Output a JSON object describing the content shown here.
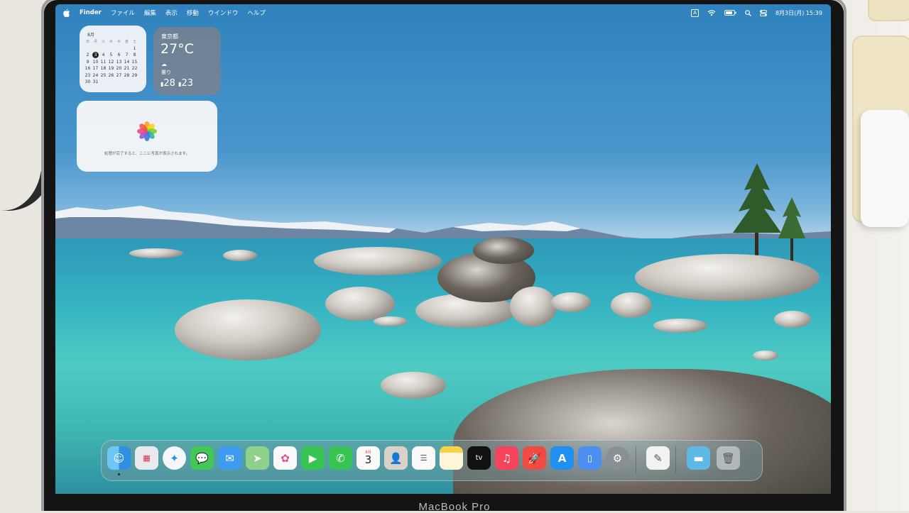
{
  "menubar": {
    "app_name": "Finder",
    "menus": [
      "ファイル",
      "編集",
      "表示",
      "移動",
      "ウインドウ",
      "ヘルプ"
    ],
    "input_source": "A",
    "clock": "8月3日(月)  15:39"
  },
  "calendar_widget": {
    "month": "8月",
    "weekdays": [
      "日",
      "月",
      "火",
      "水",
      "木",
      "金",
      "土"
    ],
    "weeks": [
      [
        "",
        "",
        "",
        "",
        "",
        "",
        "1"
      ],
      [
        "2",
        "3",
        "4",
        "5",
        "6",
        "7",
        "8"
      ],
      [
        "9",
        "10",
        "11",
        "12",
        "13",
        "14",
        "15"
      ],
      [
        "16",
        "17",
        "18",
        "19",
        "20",
        "21",
        "22"
      ],
      [
        "23",
        "24",
        "25",
        "26",
        "27",
        "28",
        "29"
      ],
      [
        "30",
        "31",
        "",
        "",
        "",
        "",
        ""
      ]
    ],
    "today": "3"
  },
  "weather_widget": {
    "city": "東京都",
    "temperature": "27°C",
    "condition": "曇り",
    "high": "28",
    "low": "23"
  },
  "photos_widget": {
    "message": "処理が完了すると、ここに写真が表示されます。"
  },
  "dock": {
    "calendar_day": "3",
    "calendar_month": "8月",
    "running_indicator_color": "#222222"
  },
  "device": {
    "brand_text": "MacBook Pro"
  }
}
